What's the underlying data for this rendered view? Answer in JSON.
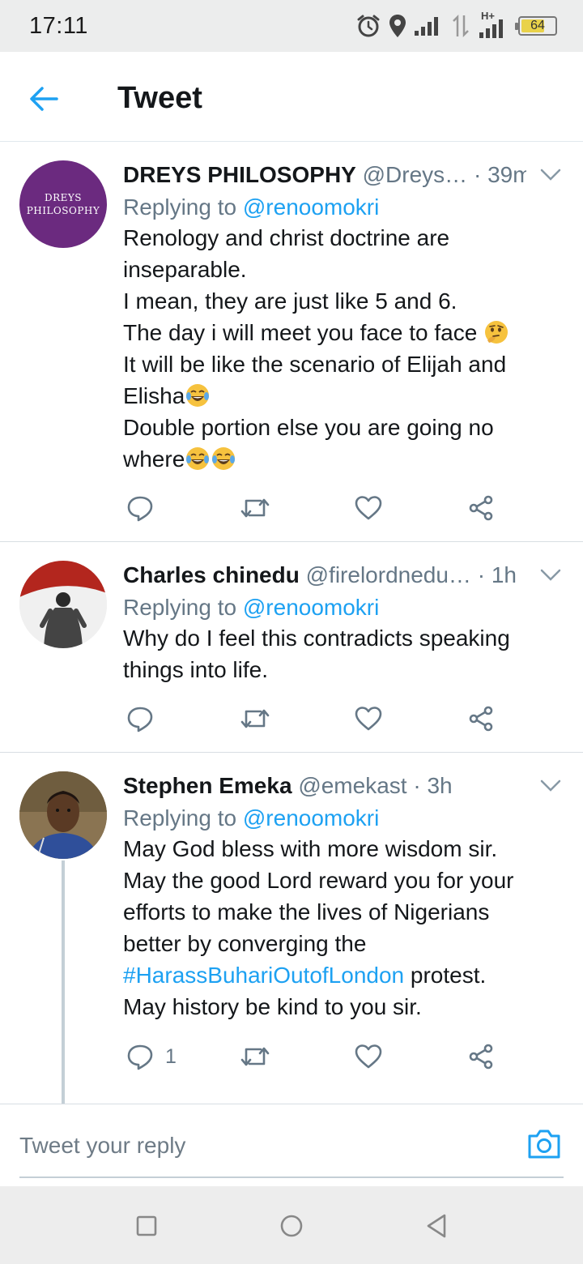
{
  "status_bar": {
    "time": "17:11",
    "network_label": "H+",
    "battery_level": "64",
    "battery_fraction": 0.64,
    "icons": [
      "alarm-icon",
      "location-icon",
      "signal-icon",
      "data-transfer-icon",
      "signal-icon",
      "battery-icon"
    ]
  },
  "header": {
    "title": "Tweet",
    "back_icon": "back-arrow-icon"
  },
  "tweets": [
    {
      "author_name": "DREYS PHILOSOPHY",
      "author_handle": "@Dreys…",
      "separator": "·",
      "time": "39m",
      "avatar_text": [
        "DREYS",
        "PHILOSOPHY"
      ],
      "replying_prefix": "Replying to",
      "replying_to": "@renoomokri",
      "lines": [
        "Renology and christ doctrine are",
        "inseparable.",
        "I mean, they are just like 5 and 6.",
        "The day i will meet you  face to face",
        "It will be like the scenario of Elijah and",
        "Elisha",
        "Double portion else you are going no",
        "where"
      ],
      "reply_count": ""
    },
    {
      "author_name": "Charles chinedu",
      "author_handle": "@firelordnedu…",
      "separator": "·",
      "time": "1h",
      "replying_prefix": "Replying to",
      "replying_to": "@renoomokri",
      "lines": [
        "Why do I feel this contradicts speaking",
        "things into life."
      ],
      "reply_count": ""
    },
    {
      "author_name": "Stephen Emeka",
      "author_handle": "@emekast",
      "separator": "·",
      "time": "3h",
      "replying_prefix": "Replying to",
      "replying_to": "@renoomokri",
      "lines": [
        "May God bless with more wisdom sir.",
        "May the good Lord reward you for your",
        "efforts to make the lives of Nigerians",
        "better by converging the",
        "protest.",
        "May history be kind to you sir."
      ],
      "hashtag": "#HarassBuhariOutofLondon",
      "reply_count": "1"
    }
  ],
  "composer": {
    "placeholder": "Tweet your reply"
  },
  "colors": {
    "accent": "#1da1f2",
    "secondary_text": "#657786",
    "avatar_purple": "#6b2a7f"
  }
}
